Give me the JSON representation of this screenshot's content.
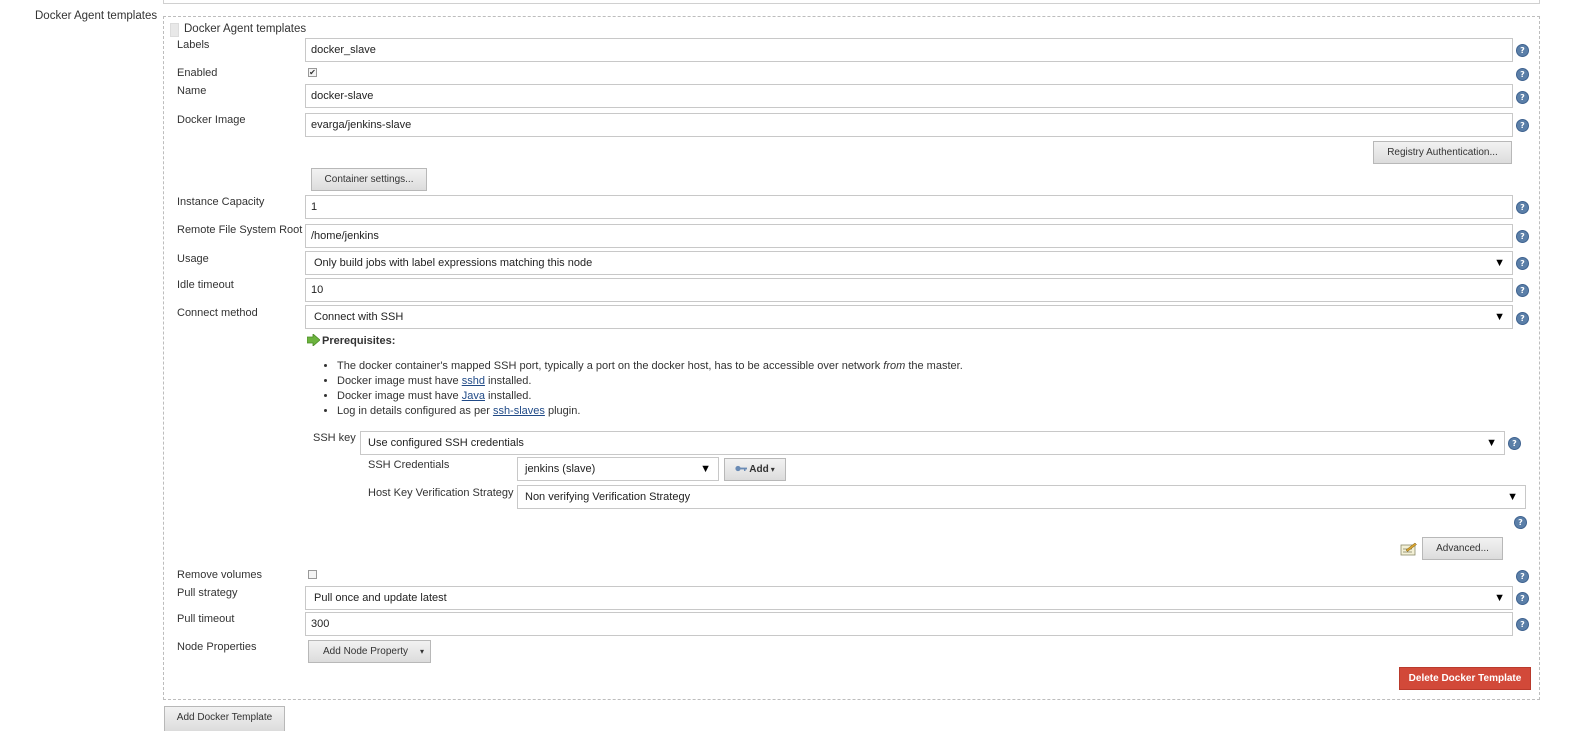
{
  "section_label": "Docker Agent templates",
  "template_header": "Docker Agent templates",
  "fields": {
    "labels": {
      "label": "Labels",
      "value": "docker_slave"
    },
    "enabled": {
      "label": "Enabled",
      "checked": true,
      "mark": "✔"
    },
    "name": {
      "label": "Name",
      "value": "docker-slave"
    },
    "docker_image": {
      "label": "Docker Image",
      "value": "evarga/jenkins-slave"
    },
    "instance_capacity": {
      "label": "Instance Capacity",
      "value": "1"
    },
    "remote_fs_root": {
      "label": "Remote File System Root",
      "value": "/home/jenkins"
    },
    "usage": {
      "label": "Usage",
      "selected": "Only build jobs with label expressions matching this node"
    },
    "idle_timeout": {
      "label": "Idle timeout",
      "value": "10"
    },
    "connect_method": {
      "label": "Connect method",
      "selected": "Connect with SSH"
    },
    "remove_volumes": {
      "label": "Remove volumes",
      "checked": false
    },
    "pull_strategy": {
      "label": "Pull strategy",
      "selected": "Pull once and update latest"
    },
    "pull_timeout": {
      "label": "Pull timeout",
      "value": "300"
    },
    "node_properties": {
      "label": "Node Properties"
    }
  },
  "buttons": {
    "registry_auth": "Registry Authentication...",
    "container_settings": "Container settings...",
    "advanced": "Advanced...",
    "add_node_property": "Add Node Property",
    "delete_template": "Delete Docker Template",
    "add_template": "Add Docker Template",
    "add_credentials": "Add"
  },
  "prerequisites": {
    "title": "Prerequisites:",
    "items": [
      {
        "pre": "The docker container's mapped SSH port, typically a port on the docker host, has to be accessible over network ",
        "em": "from",
        "post": " the master."
      },
      {
        "pre": "Docker image must have ",
        "link": "sshd",
        "post": " installed."
      },
      {
        "pre": "Docker image must have ",
        "link": "Java",
        "post": " installed."
      },
      {
        "pre": "Log in details configured as per ",
        "link": "ssh-slaves",
        "post": " plugin."
      }
    ]
  },
  "ssh": {
    "key_label": "SSH key",
    "key_selected": "Use configured SSH credentials",
    "credentials_label": "SSH Credentials",
    "credentials_selected": "jenkins (slave)",
    "host_key_label": "Host Key Verification Strategy",
    "host_key_selected": "Non verifying Verification Strategy"
  },
  "help_glyph": "?",
  "colors": {
    "delete_button": "#d24939",
    "help_icon": "#5b7fa8",
    "link": "#204a87"
  },
  "icons": [
    "help-icon",
    "green-arrow-icon",
    "key-icon",
    "notepad-icon",
    "caret-down-icon",
    "grip-handle-icon"
  ]
}
